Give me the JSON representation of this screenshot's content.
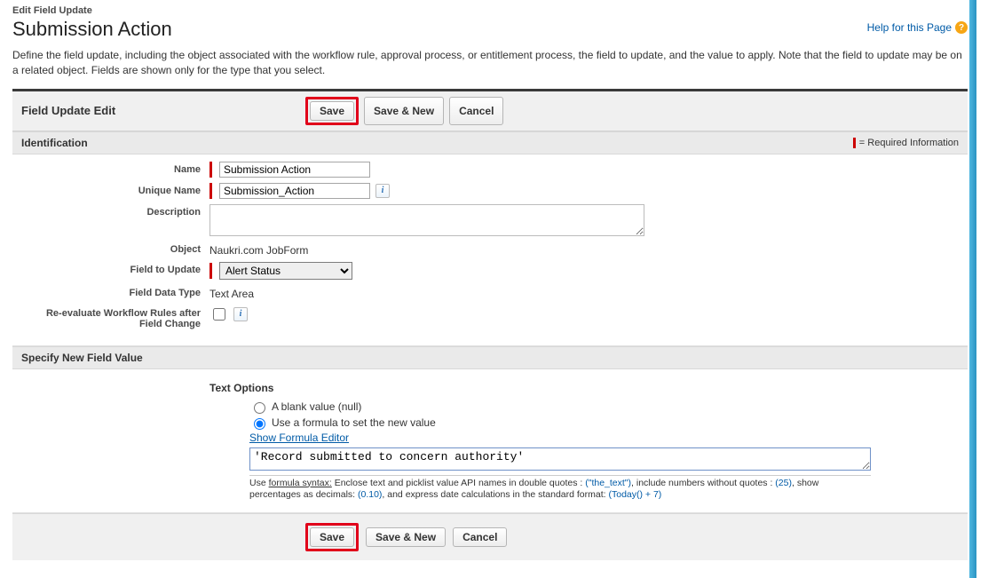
{
  "header": {
    "edit_label": "Edit Field Update",
    "title": "Submission Action",
    "help_link": "Help for this Page"
  },
  "description": "Define the field update, including the object associated with the workflow rule, approval process, or entitlement process, the field to update, and the value to apply. Note that the field to update may be on a related object. Fields are shown only for the type that you select.",
  "panel_title": "Field Update Edit",
  "buttons": {
    "save": "Save",
    "save_new": "Save & New",
    "cancel": "Cancel"
  },
  "section_identification": {
    "title": "Identification",
    "required_label": "= Required Information",
    "labels": {
      "name": "Name",
      "unique_name": "Unique Name",
      "description": "Description",
      "object": "Object",
      "field_to_update": "Field to Update",
      "field_data_type": "Field Data Type",
      "reevaluate": "Re-evaluate Workflow Rules after Field Change"
    },
    "values": {
      "name": "Submission Action",
      "unique_name": "Submission_Action",
      "description": "",
      "object": "Naukri.com JobForm",
      "field_to_update": "Alert Status",
      "field_data_type": "Text Area",
      "reevaluate_checked": false
    }
  },
  "section_specify": {
    "title": "Specify New Field Value",
    "text_options_label": "Text Options",
    "options": {
      "blank": "A blank value (null)",
      "formula": "Use a formula to set the new value",
      "selected": "formula"
    },
    "show_formula_editor": "Show Formula Editor",
    "formula_value": "'Record submitted to concern authority'",
    "syntax_hint": {
      "prefix": "Use ",
      "link": "formula syntax:",
      "part1": " Enclose text and picklist value API names in double quotes : ",
      "ex1": "(\"the_text\")",
      "part2": ", include numbers without quotes : ",
      "ex2": "(25)",
      "part3": ", show percentages as decimals: ",
      "ex3": "(0.10)",
      "part4": ", and express date calculations in the standard format: ",
      "ex4": "(Today() + 7)"
    }
  }
}
